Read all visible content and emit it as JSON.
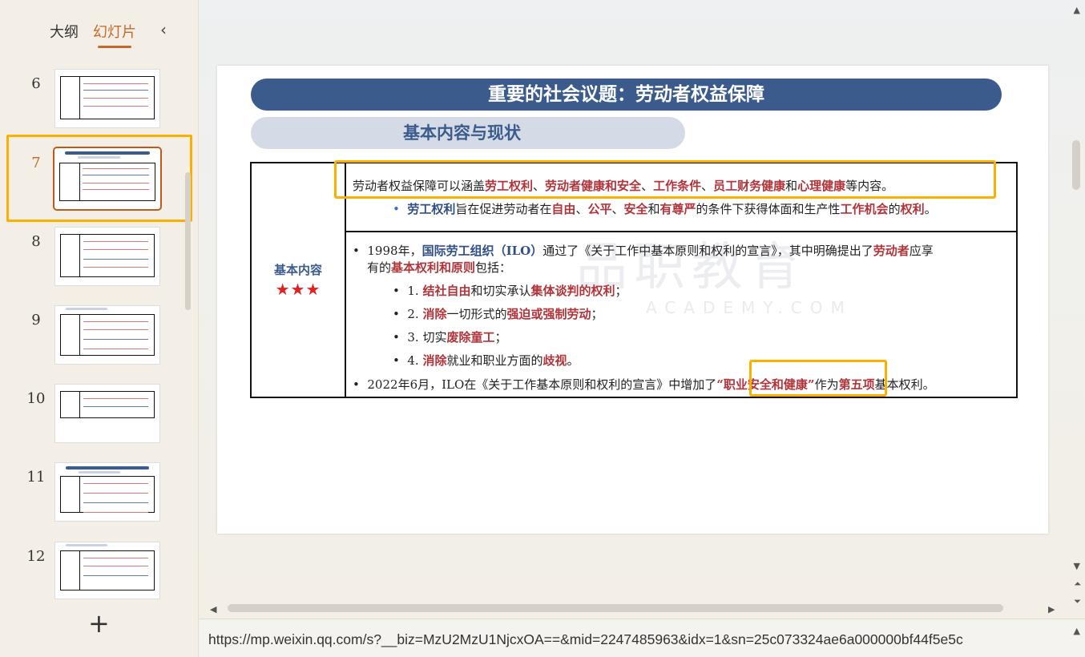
{
  "sidebar": {
    "tabs": [
      "大纲",
      "幻灯片"
    ],
    "active_tab": "幻灯片",
    "collapse_icon": "chevron-left-icon",
    "slides": [
      {
        "num": "6"
      },
      {
        "num": "7"
      },
      {
        "num": "8"
      },
      {
        "num": "9"
      },
      {
        "num": "10"
      },
      {
        "num": "11"
      },
      {
        "num": "12"
      }
    ],
    "active_slide": "7",
    "add_icon": "plus-icon"
  },
  "slide": {
    "title": "重要的社会议题：劳动者权益保障",
    "subtitle": "基本内容与现状",
    "left_label": "基本内容",
    "stars": "★★★",
    "row1": {
      "line1": [
        "劳动者权益保障可以涵盖",
        "劳工权利",
        "、",
        "劳动者健康和安全",
        "、",
        "工作条件",
        "、",
        "员工财务健康",
        "和",
        "心理健康",
        "等内容。"
      ],
      "line2": [
        "劳工权利",
        "旨在促进劳动者在",
        "自由",
        "、",
        "公平",
        "、",
        "安全",
        "和",
        "有尊严",
        "的条件下获得体面和生产性",
        "工作机会",
        "的",
        "权利",
        "。"
      ]
    },
    "row2": {
      "line1": [
        "1998年，",
        "国际劳工组织（ILO）",
        "通过了《关于工作中基本原则和权利的宣言》，其中明确提出了",
        "劳动者",
        "应享"
      ],
      "line2": [
        "有的",
        "基本权利和原则",
        "包括："
      ],
      "items": [
        [
          "1. ",
          "结社自由",
          "和切实承认",
          "集体谈判的权利",
          "；"
        ],
        [
          "2. ",
          "消除",
          "一切形式的",
          "强迫或强制劳动",
          "；"
        ],
        [
          "3. ",
          "切实",
          "废除童工",
          "；"
        ],
        [
          "4. ",
          "消除",
          "就业和职业方面的",
          "歧视",
          "。"
        ]
      ],
      "line_last": [
        "2022年6月，ILO在《关于工作基本原则和权利的宣言》中增加了",
        "“职业安全和健康”",
        "作为",
        "第五项",
        "基本权利。"
      ]
    },
    "watermark": "品职教育",
    "watermark_sub": "ACADEMY.COM"
  },
  "url_bar": {
    "text": "https://mp.weixin.qq.com/s?__biz=MzU2MzU1NjcxOA==&mid=2247485963&idx=1&sn=25c073324ae6a000000bf44f5e5c"
  },
  "colors": {
    "accent": "#c7682a",
    "highlight": "#f9b000",
    "title_bg": "#3b5b8c",
    "red_text": "#b0343a"
  }
}
